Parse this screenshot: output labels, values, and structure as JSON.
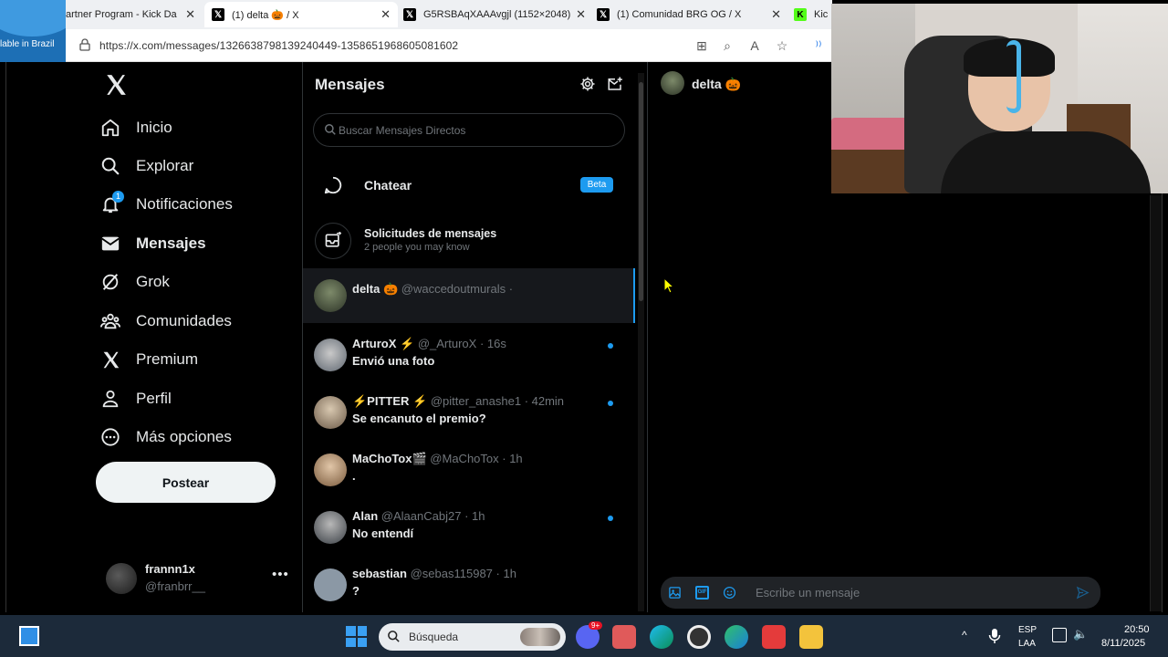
{
  "browser": {
    "side_fragment_text": "lable in Brazil",
    "tabs": [
      {
        "label": "artner Program - Kick Da",
        "favicon": "green-k"
      },
      {
        "label": "(1) delta 🎃 / X",
        "favicon": "x",
        "active": true
      },
      {
        "label": "G5RSBAqXAAAvgjl (1152×2048)",
        "favicon": "x"
      },
      {
        "label": "(1) Comunidad BRG OG / X",
        "favicon": "x"
      },
      {
        "label": "Kic",
        "favicon": "green-k"
      }
    ],
    "url": "https://x.com/messages/1326638798139240449-1358651968605081602"
  },
  "nav": {
    "logo": "X",
    "items": [
      {
        "label": "Inicio",
        "icon": "home-icon"
      },
      {
        "label": "Explorar",
        "icon": "search-icon"
      },
      {
        "label": "Notificaciones",
        "icon": "bell-icon",
        "badge": "1"
      },
      {
        "label": "Mensajes",
        "icon": "mail-icon",
        "active": true
      },
      {
        "label": "Grok",
        "icon": "grok-icon"
      },
      {
        "label": "Comunidades",
        "icon": "communities-icon"
      },
      {
        "label": "Premium",
        "icon": "x-icon"
      },
      {
        "label": "Perfil",
        "icon": "person-icon"
      },
      {
        "label": "Más opciones",
        "icon": "more-circle-icon"
      }
    ],
    "post_label": "Postear",
    "account": {
      "name": "frannn1x",
      "handle": "@franbrr__"
    }
  },
  "messages": {
    "title": "Mensajes",
    "search_placeholder": "Buscar Mensajes Directos",
    "chat": {
      "label": "Chatear",
      "badge": "Beta"
    },
    "requests": {
      "title": "Solicitudes de mensajes",
      "subtitle": "2 people you may know"
    },
    "conversations": [
      {
        "name": "delta 🎃",
        "handle": "@waccedoutmurals ·",
        "time": "",
        "preview": "",
        "unread": false,
        "selected": true
      },
      {
        "name": "ArturoX ⚡",
        "handle": "@_ArturoX",
        "time": "· 16s",
        "preview": "Envió una foto",
        "unread": true
      },
      {
        "name": "⚡PITTER ⚡",
        "handle": "@pitter_anashe1",
        "time": "· 42min",
        "preview": "Se encanuto el premio?",
        "unread": true
      },
      {
        "name": "MaChoTox🎬",
        "handle": "@MaChoTox",
        "time": "· 1h",
        "preview": ".",
        "unread": false
      },
      {
        "name": "Alan",
        "handle": "@AlaanCabj27",
        "time": "· 1h",
        "preview": "No entendí",
        "unread": true
      },
      {
        "name": "sebastian",
        "handle": "@sebas115987",
        "time": "· 1h",
        "preview": "?",
        "unread": false
      }
    ]
  },
  "chat_view": {
    "title": "delta 🎃",
    "composer_placeholder": "Escribe un mensaje"
  },
  "taskbar": {
    "search_label": "Búsqueda",
    "lang_1": "ESP",
    "lang_2": "LAA",
    "time": "20:50",
    "date": "8/11/2025",
    "discord_badge": "9+"
  },
  "colors": {
    "accent": "#1d9bf0",
    "background": "#000000",
    "text": "#e7e9ea",
    "muted": "#71767b"
  }
}
